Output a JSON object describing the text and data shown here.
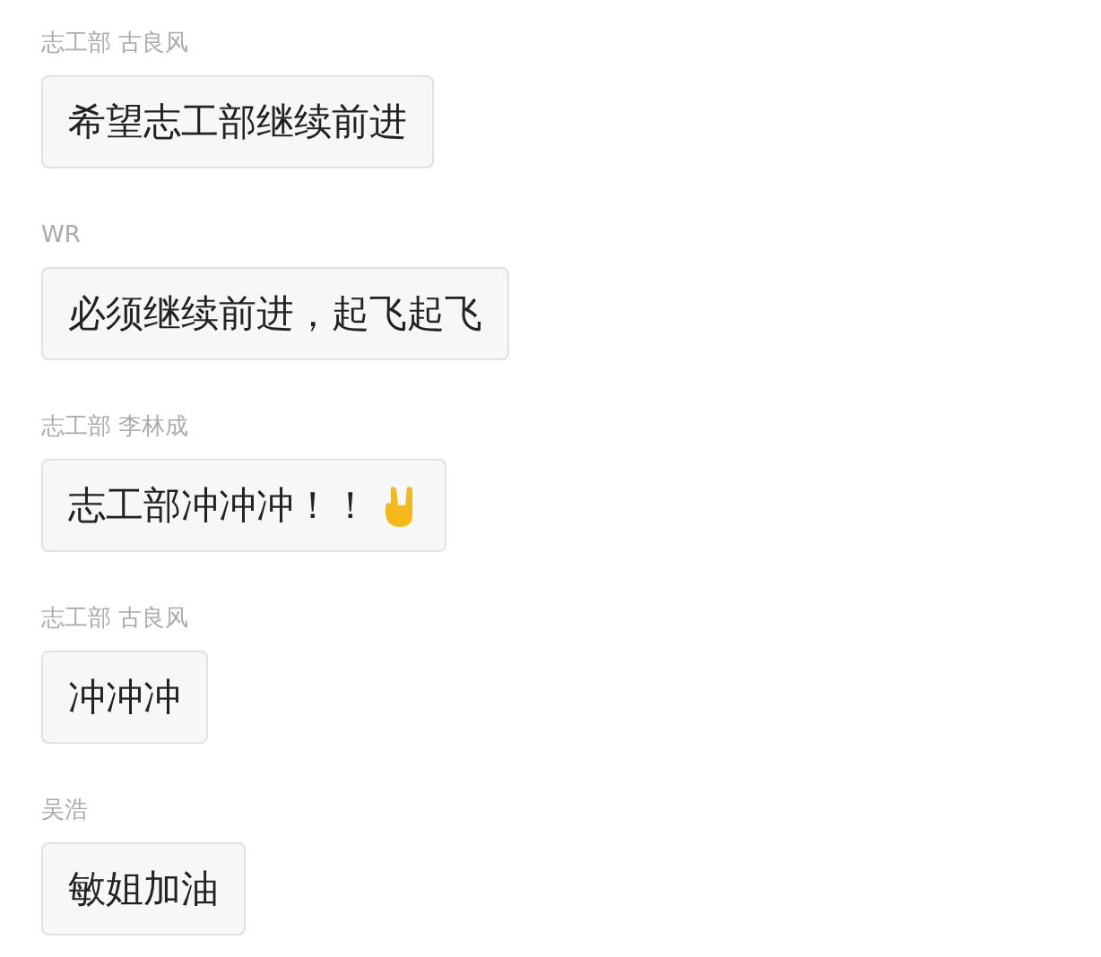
{
  "messages": [
    {
      "sender": "志工部 古良风",
      "text": "希望志工部继续前进",
      "hand_icon": false
    },
    {
      "sender": "WR",
      "text": "必须继续前进，起飞起飞",
      "hand_icon": false
    },
    {
      "sender": "志工部 李林成",
      "text": "志工部冲冲冲！！",
      "hand_icon": true
    },
    {
      "sender": "志工部 古良风",
      "text": "冲冲冲",
      "hand_icon": false
    },
    {
      "sender": "吴浩",
      "text": "敏姐加油",
      "hand_icon": false
    }
  ]
}
